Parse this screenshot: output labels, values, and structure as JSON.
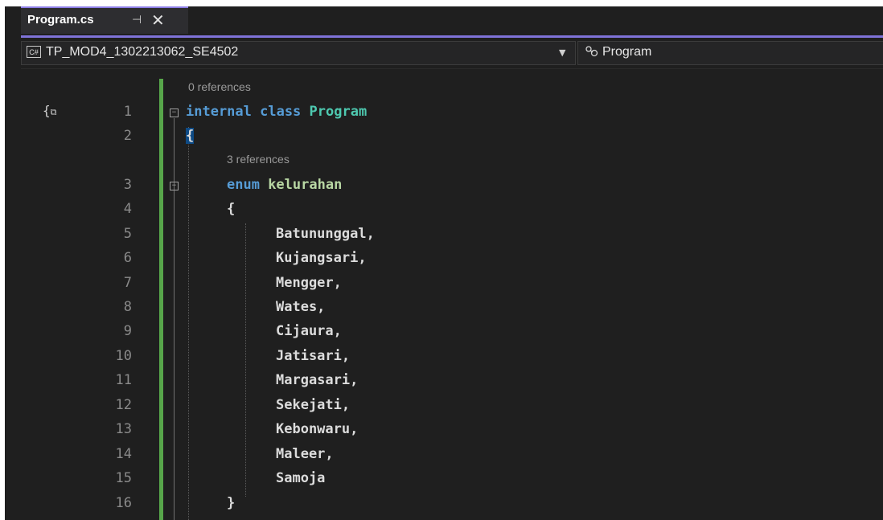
{
  "tab": {
    "title": "Program.cs",
    "pin_glyph": "⊣",
    "close_glyph": "✕"
  },
  "navbar": {
    "project_icon_text": "C#",
    "project": "TP_MOD4_1302213062_SE4502",
    "member": "Program"
  },
  "code_lens": [
    "0 references",
    "3 references"
  ],
  "lines": [
    {
      "num": "1",
      "kw": "internal class ",
      "name": "Program"
    },
    {
      "num": "2",
      "text": "{"
    },
    {
      "num": "3",
      "kw": "enum ",
      "name": "kelurahan"
    },
    {
      "num": "4",
      "text": "{"
    },
    {
      "num": "5",
      "text": "Batununggal,"
    },
    {
      "num": "6",
      "text": "Kujangsari,"
    },
    {
      "num": "7",
      "text": "Mengger,"
    },
    {
      "num": "8",
      "text": "Wates,"
    },
    {
      "num": "9",
      "text": "Cijaura,"
    },
    {
      "num": "10",
      "text": "Jatisari,"
    },
    {
      "num": "11",
      "text": "Margasari,"
    },
    {
      "num": "12",
      "text": "Sekejati,"
    },
    {
      "num": "13",
      "text": "Kebonwaru,"
    },
    {
      "num": "14",
      "text": "Maleer,"
    },
    {
      "num": "15",
      "text": "Samoja"
    },
    {
      "num": "16",
      "text": "}"
    }
  ],
  "colors": {
    "background": "#1f1f1f",
    "keyword": "#569cd6",
    "class_name": "#4ec9b0",
    "enum_name": "#b8d7a3",
    "change_bar": "#57a64a",
    "tab_accent": "#7f73d8"
  },
  "icons": [
    "cs-project-icon",
    "class-icon",
    "scope-icon",
    "pin-icon",
    "close-icon",
    "chevron-down-icon"
  ]
}
